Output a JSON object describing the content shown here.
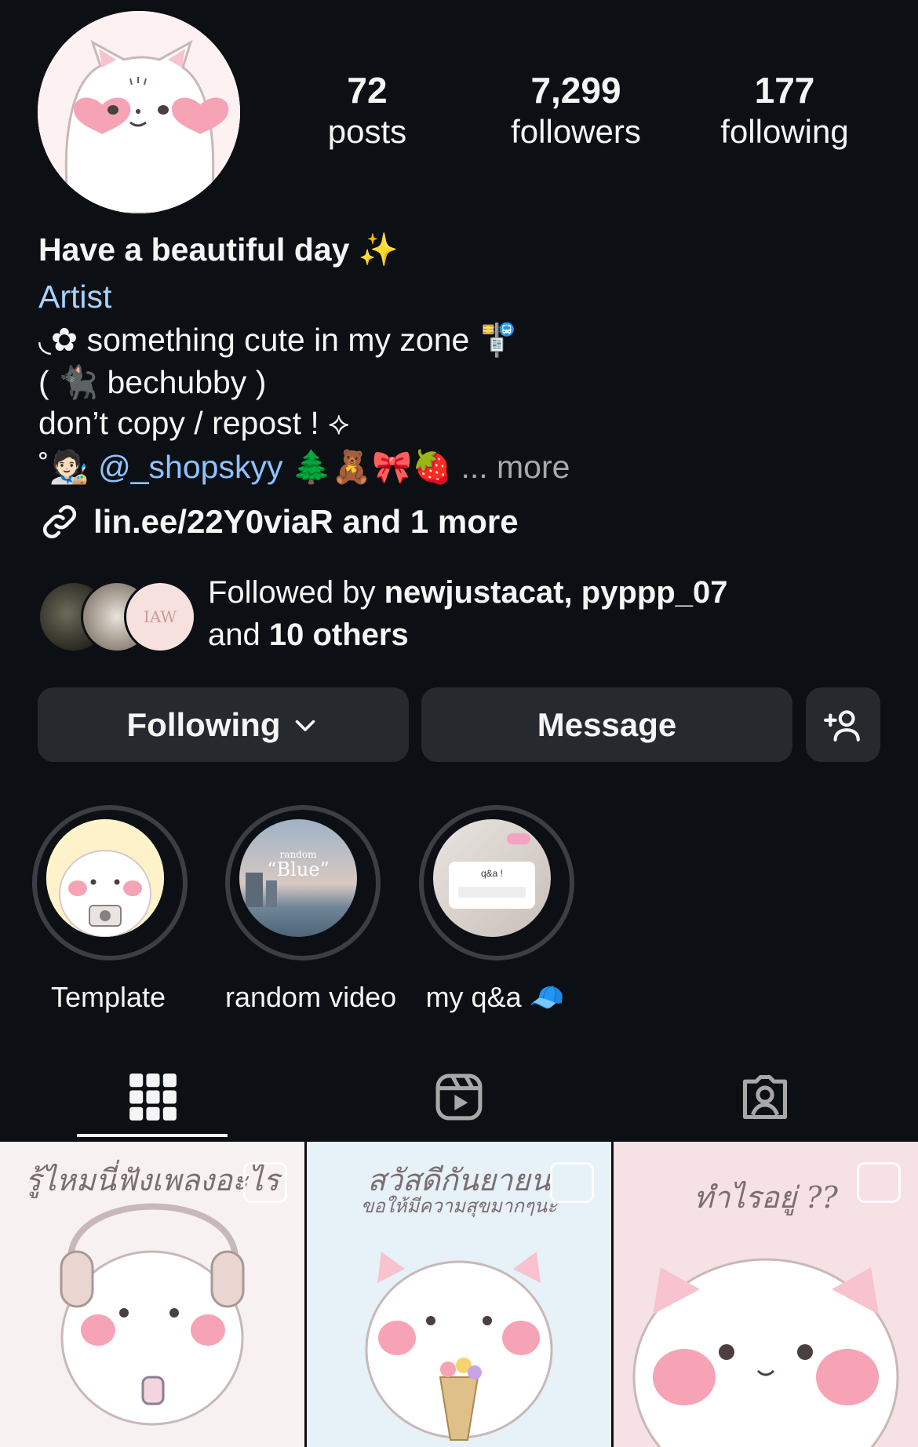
{
  "profile": {
    "stats": [
      {
        "num": "72",
        "label": "posts"
      },
      {
        "num": "7,299",
        "label": "followers"
      },
      {
        "num": "177",
        "label": "following"
      }
    ],
    "bio": {
      "title": "Have a beautiful day ✨",
      "category": "Artist",
      "line1": "◟✿  something cute in my zone 🚏",
      "line2": "( 🐈‍⬛ bechubby )",
      "line3": "don’t copy / repost ! ⟡",
      "line4_prefix": "˚🧑🏻‍🎨 ",
      "mention": "@_shopskyy",
      "line4_suffix": "  🌲🧸🎀🍓",
      "more": "... more"
    },
    "link": "lin.ee/22Y0viaR and 1 more",
    "followed_by": {
      "prefix": "Followed by ",
      "names": "newjustacat, pypp p_07",
      "names_exact": "newjustacat, pyppp_07",
      "line2_prefix": "and ",
      "others": "10 others"
    },
    "avatar_mini_text": "IAW"
  },
  "buttons": {
    "following": "Following",
    "message": "Message"
  },
  "highlights": [
    {
      "label": "Template"
    },
    {
      "label": "random video"
    },
    {
      "label": "my q&a 🧢"
    }
  ],
  "highlight_thumb_text": {
    "random": "random",
    "blue": "“Blue”",
    "qa": "q&a !"
  },
  "tabs": [
    {
      "icon": "grid-icon"
    },
    {
      "icon": "reels-icon"
    },
    {
      "icon": "tagged-icon"
    }
  ],
  "posts": [
    {
      "caption": "รู้ไหมนี่ฟังเพลงอะไร",
      "bg": "#f7f1f1"
    },
    {
      "caption": "สวัสดีกันยายน",
      "caption2": "ขอให้มีความสุขมากๆนะ",
      "bg": "#e6f1f8"
    },
    {
      "caption": "ทำไรอยู่ ??",
      "bg": "#f6e1e5"
    }
  ],
  "colors": {
    "background": "#0c1014",
    "button": "#262a2f",
    "category": "#a8d1ff",
    "mention": "#8fc2ff",
    "cheek": "#f5a3b5"
  }
}
